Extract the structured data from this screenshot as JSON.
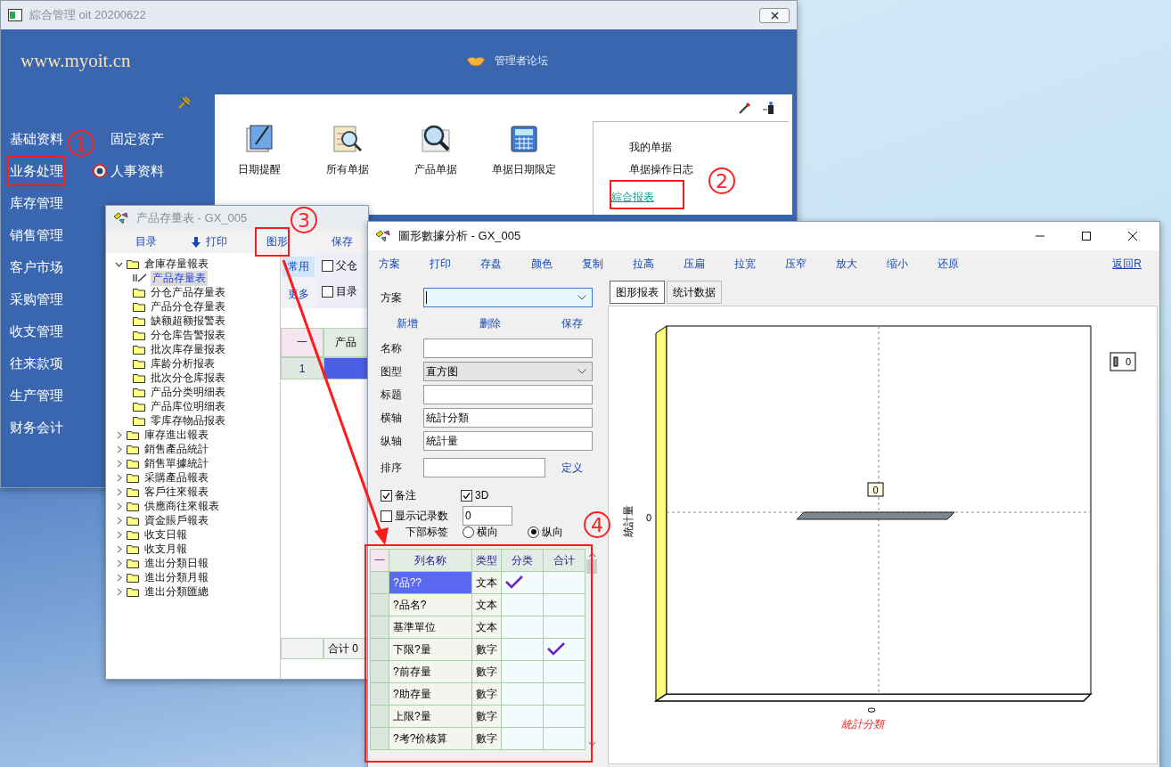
{
  "main_window": {
    "title": "綜合管理 oit 20200622",
    "site": "www.myoit.cn",
    "forum_link": "管理者论坛",
    "nav_left": [
      "基础资料",
      "业务处理",
      "库存管理",
      "销售管理",
      "客户市场",
      "采购管理",
      "收支管理",
      "往来款项",
      "生产管理",
      "财务会计"
    ],
    "nav_right": [
      {
        "label": "固定资产",
        "kind": "text"
      },
      {
        "label": "人事资料",
        "kind": "icon"
      }
    ],
    "shortcuts": [
      {
        "label": "日期提醒",
        "kind": "notepad"
      },
      {
        "label": "所有单据",
        "kind": "document-search"
      },
      {
        "label": "产品单据",
        "kind": "magnifier"
      },
      {
        "label": "单据日期限定",
        "kind": "calculator"
      }
    ],
    "quick_links": [
      {
        "label": "我的单据",
        "kind": "text"
      },
      {
        "label": "单据操作日志",
        "kind": "text"
      },
      {
        "label": "綜合报表",
        "kind": "link"
      }
    ]
  },
  "report_window": {
    "title": "产品存量表 - GX_005",
    "toolbar": [
      {
        "label": "目录",
        "kind": "text"
      },
      {
        "label": "打印",
        "kind": "print"
      },
      {
        "label": "图形",
        "kind": "text"
      },
      {
        "label": "保存",
        "kind": "text"
      }
    ],
    "tree": [
      {
        "label": "倉庫存量報表",
        "expanded": true,
        "selected": false,
        "children": [
          {
            "label": "产品存量表",
            "kind": "report",
            "selected": true
          },
          {
            "label": "分仓产品存量表",
            "kind": "folder",
            "selected": false
          },
          {
            "label": "产品分仓存量表",
            "kind": "folder",
            "selected": false
          },
          {
            "label": "缺额超额报警表",
            "kind": "folder",
            "selected": false
          },
          {
            "label": "分仓库告警报表",
            "kind": "folder",
            "selected": false
          },
          {
            "label": "批次库存量报表",
            "kind": "folder",
            "selected": false
          },
          {
            "label": "库龄分析报表",
            "kind": "folder",
            "selected": false
          },
          {
            "label": "批次分仓库报表",
            "kind": "folder",
            "selected": false
          },
          {
            "label": "产品分类明细表",
            "kind": "folder",
            "selected": false
          },
          {
            "label": "产品库位明细表",
            "kind": "folder",
            "selected": false
          },
          {
            "label": "零库存物品报表",
            "kind": "folder",
            "selected": false
          }
        ]
      },
      {
        "label": "庫存進出報表",
        "expanded": false,
        "selected": false
      },
      {
        "label": "銷售產品統計",
        "expanded": false,
        "selected": false
      },
      {
        "label": "銷售單據統計",
        "expanded": false,
        "selected": false
      },
      {
        "label": "采購產品報表",
        "expanded": false,
        "selected": false
      },
      {
        "label": "客戶往來報表",
        "expanded": false,
        "selected": false
      },
      {
        "label": "供應商往來報表",
        "expanded": false,
        "selected": false
      },
      {
        "label": "資金賬戶報表",
        "expanded": false,
        "selected": false
      },
      {
        "label": "收支日報",
        "expanded": false,
        "selected": false
      },
      {
        "label": "收支月報",
        "expanded": false,
        "selected": false
      },
      {
        "label": "進出分類日報",
        "expanded": false,
        "selected": false
      },
      {
        "label": "進出分類月報",
        "expanded": false,
        "selected": false
      },
      {
        "label": "進出分類匯總",
        "expanded": false,
        "selected": false
      }
    ],
    "view_tabs": [
      {
        "label": "常用",
        "selected": true
      },
      {
        "label": "更多",
        "selected": false
      }
    ],
    "options": [
      {
        "label": "父仓",
        "checked": false
      },
      {
        "label": "目录",
        "checked": false
      }
    ],
    "grid_header": [
      "一",
      "产品"
    ],
    "grid_row": "1",
    "footer": "合计 0"
  },
  "chart_window": {
    "title": "圖形數據分析 - GX_005",
    "menu": [
      "方案",
      "打印",
      "存盘",
      "颜色",
      "复制",
      "拉高",
      "压扁",
      "拉宽",
      "压窄",
      "放大",
      "缩小",
      "还原"
    ],
    "back": "返回R",
    "scheme_label": "方案",
    "actions": [
      "新增",
      "删除",
      "保存"
    ],
    "fields": [
      {
        "label": "名称",
        "kind": "text"
      },
      {
        "label": "图型",
        "value": "直方图",
        "kind": "select"
      },
      {
        "label": "标题",
        "kind": "text"
      },
      {
        "label": "横轴",
        "value": "統計分類",
        "kind": "text"
      },
      {
        "label": "纵轴",
        "value": "統計量",
        "kind": "text"
      }
    ],
    "sort": {
      "label": "排序",
      "link": "定义"
    },
    "checks": [
      {
        "label": "备注",
        "checked": true
      },
      {
        "label": "3D",
        "checked": true
      }
    ],
    "record_count": {
      "label": "显示记录数",
      "checked": false,
      "value": "0"
    },
    "bottom_label": {
      "label": "下部标签",
      "options": [
        {
          "label": "横向",
          "selected": false
        },
        {
          "label": "纵向",
          "selected": true
        }
      ]
    },
    "columns_table": {
      "columns": [
        "一",
        "列名称",
        "类型",
        "分类",
        "合计"
      ],
      "rows": [
        {
          "name": "?品??",
          "type": "文本",
          "category": true,
          "total": false,
          "selected": true
        },
        {
          "name": "?品名?",
          "type": "文本",
          "category": false,
          "total": false,
          "selected": false
        },
        {
          "name": "基準單位",
          "type": "文本",
          "category": false,
          "total": false,
          "selected": false
        },
        {
          "name": "下限?量",
          "type": "數字",
          "category": false,
          "total": true,
          "selected": false
        },
        {
          "name": "?前存量",
          "type": "數字",
          "category": false,
          "total": false,
          "selected": false
        },
        {
          "name": "?助存量",
          "type": "數字",
          "category": false,
          "total": false,
          "selected": false
        },
        {
          "name": "上限?量",
          "type": "數字",
          "category": false,
          "total": false,
          "selected": false
        },
        {
          "name": "?考?价核算",
          "type": "數字",
          "category": false,
          "total": false,
          "selected": false
        }
      ]
    },
    "tabs": [
      {
        "label": "图形报表",
        "selected": true
      },
      {
        "label": "统计数据",
        "selected": false
      }
    ],
    "chart": {
      "x_axis_title": "統計分類",
      "y_axis_title": "統計量",
      "x_tick": "0",
      "y_tick": "0",
      "bar_label": "0",
      "legend": "0"
    }
  },
  "annotations": [
    "1",
    "2",
    "3",
    "4"
  ]
}
